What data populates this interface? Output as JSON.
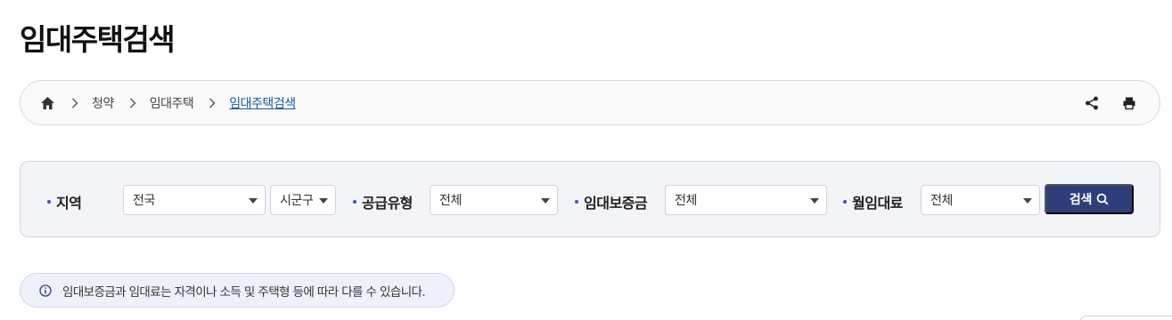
{
  "page": {
    "title": "임대주택검색"
  },
  "breadcrumb": {
    "home_icon": "home-icon",
    "items": [
      {
        "label": "청약"
      },
      {
        "label": "임대주택"
      },
      {
        "label": "임대주택검색"
      }
    ],
    "actions": {
      "share_icon": "share-icon",
      "print_icon": "print-icon"
    }
  },
  "search": {
    "region": {
      "label": "지역",
      "province_value": "전국",
      "city_value": "시군구"
    },
    "supply_type": {
      "label": "공급유형",
      "value": "전체"
    },
    "deposit": {
      "label": "임대보증금",
      "value": "전체"
    },
    "monthly_rent": {
      "label": "월임대료",
      "value": "전체"
    },
    "button_label": "검색"
  },
  "notice": {
    "icon": "info-icon",
    "text": "임대보증금과 임대료는 자격이나 소득 및 주택형 등에 따라 다를 수 있습니다."
  },
  "colors": {
    "primary": "#2d3e78",
    "link": "#0f5fa8",
    "bullet": "#3b53c4",
    "notice_bg": "#eef1fb"
  }
}
